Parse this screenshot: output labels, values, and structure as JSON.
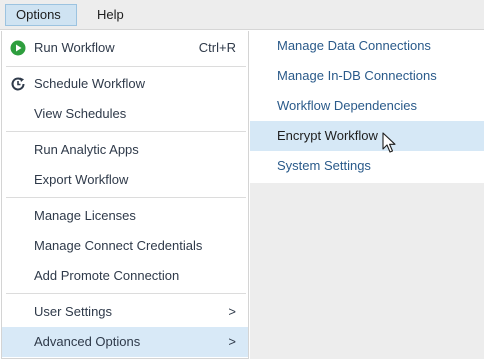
{
  "menubar": {
    "options_label": "Options",
    "help_label": "Help"
  },
  "menu": {
    "items": [
      {
        "label": "Run Workflow",
        "shortcut": "Ctrl+R",
        "icon": "play-icon"
      },
      {
        "label": "Schedule Workflow",
        "icon": "schedule-icon"
      },
      {
        "label": "View Schedules"
      },
      {
        "label": "Run Analytic Apps"
      },
      {
        "label": "Export Workflow"
      },
      {
        "label": "Manage Licenses"
      },
      {
        "label": "Manage Connect Credentials"
      },
      {
        "label": "Add Promote Connection"
      },
      {
        "label": "User Settings",
        "arrow": ">"
      },
      {
        "label": "Advanced Options",
        "arrow": ">"
      }
    ]
  },
  "submenu": {
    "items": [
      {
        "label": "Manage Data Connections"
      },
      {
        "label": "Manage In-DB Connections"
      },
      {
        "label": "Workflow Dependencies"
      },
      {
        "label": "Encrypt Workflow"
      },
      {
        "label": "System Settings"
      }
    ]
  },
  "colors": {
    "accent_play": "#2e9e3e",
    "highlight": "#d8e9f7",
    "link_text": "#2a5a8a"
  }
}
